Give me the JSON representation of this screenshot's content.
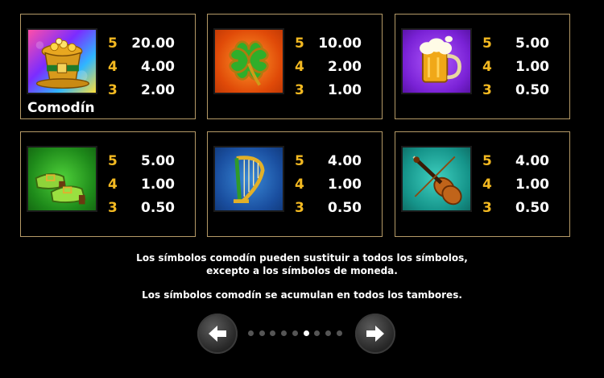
{
  "paytable": [
    {
      "symbol_icon": "leprechaun-hat-wild-icon",
      "label": "Comodín",
      "pays": [
        {
          "count": "5",
          "value": "20.00"
        },
        {
          "count": "4",
          "value": "4.00"
        },
        {
          "count": "3",
          "value": "2.00"
        }
      ]
    },
    {
      "symbol_icon": "four-leaf-clover-icon",
      "pays": [
        {
          "count": "5",
          "value": "10.00"
        },
        {
          "count": "4",
          "value": "2.00"
        },
        {
          "count": "3",
          "value": "1.00"
        }
      ]
    },
    {
      "symbol_icon": "beer-mug-icon",
      "pays": [
        {
          "count": "5",
          "value": "5.00"
        },
        {
          "count": "4",
          "value": "1.00"
        },
        {
          "count": "3",
          "value": "0.50"
        }
      ]
    },
    {
      "symbol_icon": "buckle-shoes-icon",
      "pays": [
        {
          "count": "5",
          "value": "5.00"
        },
        {
          "count": "4",
          "value": "1.00"
        },
        {
          "count": "3",
          "value": "0.50"
        }
      ]
    },
    {
      "symbol_icon": "harp-icon",
      "pays": [
        {
          "count": "5",
          "value": "4.00"
        },
        {
          "count": "4",
          "value": "1.00"
        },
        {
          "count": "3",
          "value": "0.50"
        }
      ]
    },
    {
      "symbol_icon": "fiddle-icon",
      "pays": [
        {
          "count": "5",
          "value": "4.00"
        },
        {
          "count": "4",
          "value": "1.00"
        },
        {
          "count": "3",
          "value": "0.50"
        }
      ]
    }
  ],
  "info": {
    "line1": "Los símbolos comodín pueden sustituir a todos los símbolos,",
    "line2": "excepto a los símbolos de moneda.",
    "line3": "Los símbolos comodín se acumulan en todos los tambores."
  },
  "pagination": {
    "total_pages": 9,
    "current_page": 6
  },
  "colors": {
    "multiplier": "#f3b921",
    "value": "#ffffff",
    "border": "#b59a67",
    "background": "#000000"
  }
}
